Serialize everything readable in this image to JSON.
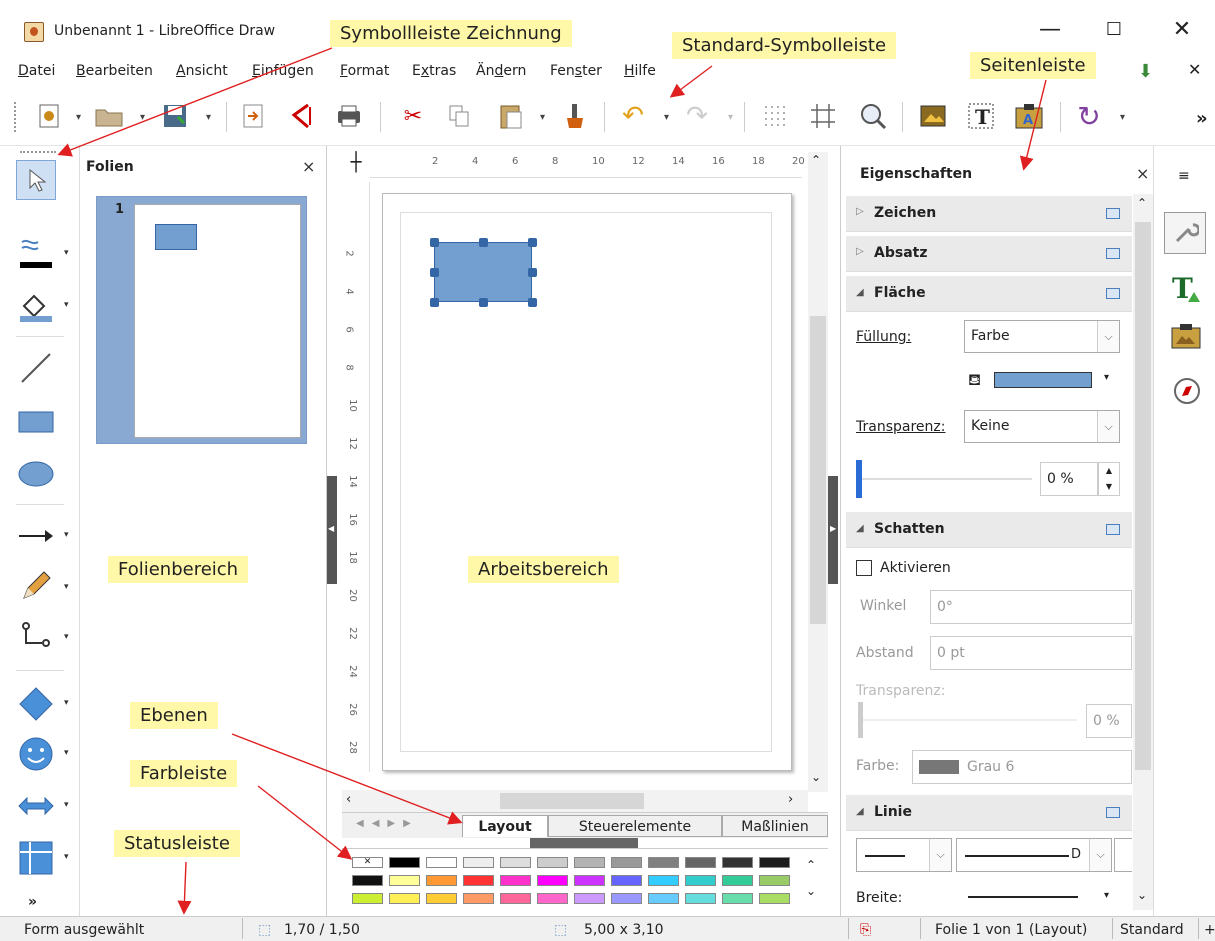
{
  "window": {
    "title": "Unbenannt 1 - LibreOffice Draw",
    "min_glyph": "—",
    "max_glyph": "☐",
    "close_glyph": "✕",
    "menu_close_glyph": "✕"
  },
  "menu": [
    "Datei",
    "Bearbeiten",
    "Ansicht",
    "Einfügen",
    "Format",
    "Extras",
    "Ändern",
    "Fenster",
    "Hilfe"
  ],
  "menu_access": [
    "D",
    "B",
    "A",
    "E",
    "F",
    "x",
    "d",
    "s",
    "H"
  ],
  "slides": {
    "title": "Folien",
    "close": "×",
    "slide_number": "1"
  },
  "canvas": {
    "ruler_h": [
      "2",
      "4",
      "6",
      "8",
      "10",
      "12",
      "14",
      "16",
      "18",
      "20"
    ],
    "ruler_v": [
      "2",
      "4",
      "6",
      "8",
      "10",
      "12",
      "14",
      "16",
      "18",
      "20",
      "22",
      "24",
      "26",
      "28"
    ]
  },
  "tabs": [
    "Layout",
    "Steuerelemente",
    "Maßlinien"
  ],
  "sidebar": {
    "title": "Eigenschaften",
    "close": "×",
    "sections": {
      "zeichen": "Zeichen",
      "absatz": "Absatz",
      "flaeche": "Fläche",
      "schatten": "Schatten",
      "linie": "Linie"
    },
    "fuellung_label": "Füllung:",
    "fuellung_value": "Farbe",
    "fill_color": "#729fcf",
    "transparenz_label": "Transparenz:",
    "transparenz_value": "Keine",
    "transparenz_percent": "0 %",
    "aktivieren": "Aktivieren",
    "winkel_label": "Winkel",
    "winkel_value": "0°",
    "abstand_label": "Abstand",
    "abstand_value": "0 pt",
    "schatten_transparenz_label": "Transparenz:",
    "schatten_transparenz_value": "0 %",
    "farbe_label": "Farbe:",
    "farbe_value": "Grau 6",
    "line_d": "D",
    "breite_label": "Breite:"
  },
  "status": {
    "mode": "Form ausgewählt",
    "position": "1,70 / 1,50",
    "size": "5,00 x 3,10",
    "slide": "Folie 1 von 1 (Layout)",
    "layout": "Standard"
  },
  "annotations": {
    "drawing_toolbar": "Symbollleiste Zeichnung",
    "standard_toolbar": "Standard-Symbolleiste",
    "sidebar": "Seitenleiste",
    "slide_pane": "Folienbereich",
    "work_area": "Arbeitsbereich",
    "layers": "Ebenen",
    "color_bar": "Farbleiste",
    "status_bar": "Statusleiste"
  },
  "palette": {
    "row1": [
      "#ffffff",
      "#000000",
      "#ffffff",
      "#eeeeee",
      "#dddddd",
      "#cccccc",
      "#b3b3b3",
      "#999999",
      "#808080",
      "#666666",
      "#333333",
      "#1c1c1c"
    ],
    "row2": [
      "#111111",
      "#ffff99",
      "#ff9933",
      "#ff3333",
      "#ff33cc",
      "#ff00ff",
      "#cc33ff",
      "#6666ff",
      "#33ccff",
      "#33cccc",
      "#33cc99",
      "#99cc66"
    ],
    "row3": [
      "#ccee33",
      "#ffee55",
      "#ffcc33",
      "#ff9966",
      "#ff6699",
      "#ff66cc",
      "#cc99ff",
      "#9999ff",
      "#66ccff",
      "#66dddd",
      "#66ddaa",
      "#aadd66"
    ]
  }
}
